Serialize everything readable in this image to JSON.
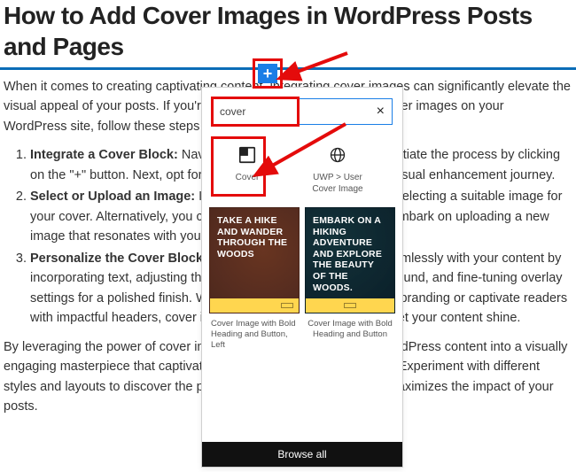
{
  "title": "How to Add Cover Images in WordPress Posts and Pages",
  "intro": "When it comes to creating captivating content, integrating cover images can significantly elevate the visual appeal of your posts. If you're encountering challenges with cover images on your WordPress site, follow these steps to address the issue effectively.",
  "steps": [
    {
      "label": "Integrate a Cover Block:",
      "text": " Navigate to the desired location and initiate the process by clicking on the \"+\" button. Next, opt for the Cover block to kickstart your visual enhancement journey."
    },
    {
      "label": "Select or Upload an Image:",
      "text": " Infuse life into your cover block by selecting a suitable image for your cover. Alternatively, you can explore your Media Library or embark on uploading a new image that resonates with your content."
    },
    {
      "label": "Personalize the Cover Block:",
      "text": " Tailor the cover block to align seamlessly with your content by incorporating text, adjusting the focal point, modifying the background, and fine-tuning overlay settings for a polished finish. Whether you aim to showcase your branding or captivate readers with impactful headers, cover images offer a versatile canvas to let your content shine."
    }
  ],
  "closing": "By leveraging the power of cover images, you can transform your WordPress content into a visually engaging masterpiece that captivates your audience from the get-go. Experiment with different styles and layouts to discover the perfect cover image strategy that maximizes the impact of your posts.",
  "inserter": {
    "search_value": "cover",
    "close_label": "×",
    "blocks": {
      "cover": "Cover",
      "uwp": "UWP > User Cover Image"
    },
    "patterns": {
      "left_text": "TAKE A HIKE AND WANDER THROUGH THE WOODS",
      "right_text": "EMBARK ON A HIKING ADVENTURE AND EXPLORE THE BEAUTY OF THE WOODS.",
      "left_caption": "Cover Image with Bold Heading and Button, Left",
      "right_caption": "Cover Image with Bold Heading and Button"
    },
    "browse_all": "Browse all"
  },
  "plus_label": "+"
}
